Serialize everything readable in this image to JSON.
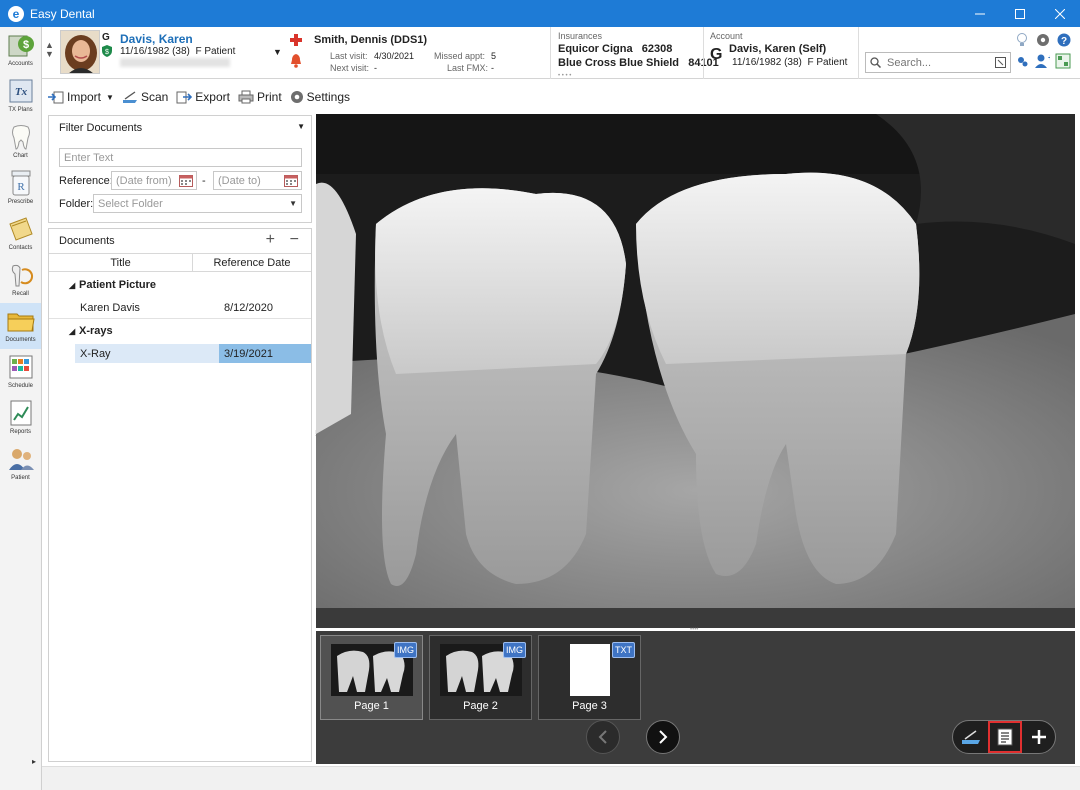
{
  "app": {
    "title": "Easy Dental"
  },
  "sidebar": {
    "items": [
      {
        "label": "Accounts",
        "icon": "accounts-icon"
      },
      {
        "label": "TX Plans",
        "icon": "tx-plans-icon"
      },
      {
        "label": "Chart",
        "icon": "chart-tooth-icon"
      },
      {
        "label": "Prescribe",
        "icon": "prescribe-icon"
      },
      {
        "label": "Contacts",
        "icon": "contacts-icon"
      },
      {
        "label": "Recall",
        "icon": "recall-icon"
      },
      {
        "label": "Documents",
        "icon": "documents-folder-icon"
      },
      {
        "label": "Schedule",
        "icon": "schedule-icon"
      },
      {
        "label": "Reports",
        "icon": "reports-icon"
      },
      {
        "label": "Patient",
        "icon": "patient-icon"
      }
    ],
    "active": "Documents"
  },
  "patient": {
    "name": "Davis, Karen",
    "dob_line": "11/16/1982 (38)",
    "gender_status": "F Patient",
    "badge": "G"
  },
  "provider": {
    "name": "Smith, Dennis (DDS1)",
    "last_visit_label": "Last visit:",
    "last_visit": "4/30/2021",
    "next_visit_label": "Next visit:",
    "next_visit": "-",
    "missed_label": "Missed appt:",
    "missed": "5",
    "fmx_label": "Last FMX:",
    "fmx": "-"
  },
  "insurances": {
    "label": "Insurances",
    "primary": "Equicor Cigna",
    "primary_code": "62308",
    "secondary": "Blue Cross Blue Shield",
    "secondary_code": "84101"
  },
  "account": {
    "label": "Account",
    "badge": "G",
    "name": "Davis, Karen (Self)",
    "dob_line": "11/16/1982 (38)",
    "status": "F Patient"
  },
  "search": {
    "placeholder": "Search..."
  },
  "toolbar": {
    "import": "Import",
    "scan": "Scan",
    "export": "Export",
    "print": "Print",
    "settings": "Settings"
  },
  "filter": {
    "title": "Filter Documents",
    "text_placeholder": "Enter Text",
    "reference_label": "Reference:",
    "date_from": "(Date from)",
    "date_sep": "-",
    "date_to": "(Date to)",
    "folder_label": "Folder:",
    "folder_placeholder": "Select Folder"
  },
  "documents": {
    "title": "Documents",
    "col_title": "Title",
    "col_date": "Reference Date",
    "groups": [
      {
        "name": "Patient Picture",
        "rows": [
          {
            "title": "Karen Davis",
            "date": "8/12/2020"
          }
        ]
      },
      {
        "name": "X-rays",
        "rows": [
          {
            "title": "X-Ray",
            "date": "3/19/2021"
          }
        ]
      }
    ]
  },
  "thumbs": [
    {
      "label": "Page 1",
      "badge": "IMG"
    },
    {
      "label": "Page 2",
      "badge": "IMG"
    },
    {
      "label": "Page 3",
      "badge": "TXT"
    }
  ],
  "colors": {
    "titlebar": "#1e7bd6",
    "accent_link": "#1e6fb8",
    "selection": "#8bbde6",
    "highlight_border": "#e03030"
  }
}
